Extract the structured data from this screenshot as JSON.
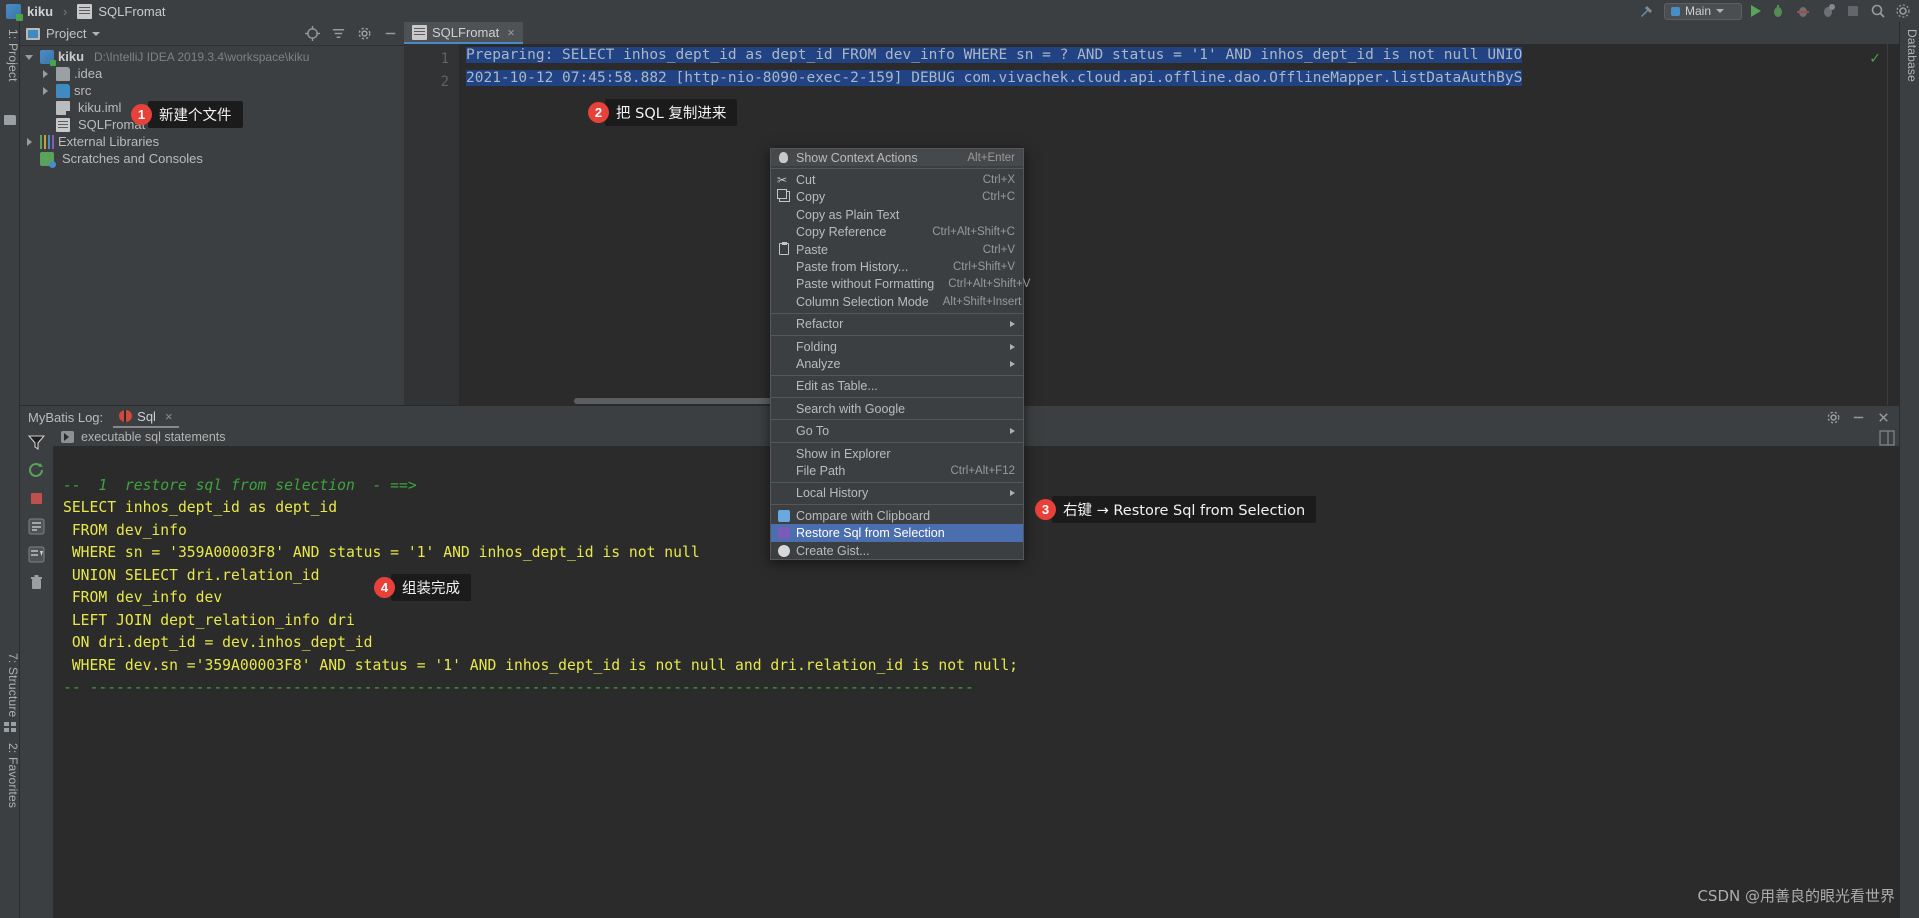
{
  "window": {
    "breadcrumb": {
      "project": "kiku",
      "file": "SQLFromat",
      "separator": "›"
    },
    "run_config": "Main"
  },
  "project_panel": {
    "title": "Project",
    "tree": [
      {
        "label": "kiku",
        "path": "D:\\IntelliJ IDEA 2019.3.4\\workspace\\kiku",
        "icon": "module-icon",
        "expanded": true,
        "depth": 0
      },
      {
        "label": ".idea",
        "path": "",
        "icon": "folder-icon",
        "expanded": false,
        "depth": 1
      },
      {
        "label": "src",
        "path": "",
        "icon": "source-folder-icon",
        "expanded": false,
        "depth": 1
      },
      {
        "label": "kiku.iml",
        "path": "",
        "icon": "iml-file-icon",
        "expanded": null,
        "depth": 1
      },
      {
        "label": "SQLFromat",
        "path": "",
        "icon": "text-file-icon",
        "expanded": null,
        "depth": 1
      },
      {
        "label": "External Libraries",
        "path": "",
        "icon": "libraries-icon",
        "expanded": false,
        "depth": 0
      },
      {
        "label": "Scratches and Consoles",
        "path": "",
        "icon": "scratches-icon",
        "expanded": null,
        "depth": 0
      }
    ]
  },
  "left_tool_strip": {
    "project_tab": "1: Project",
    "structure_tab": "7: Structure",
    "favorites_tab": "2: Favorites"
  },
  "right_tool_strip": {
    "database_tab": "Database"
  },
  "editor": {
    "tab_label": "SQLFromat",
    "tab_close": "×",
    "line_numbers": [
      "1",
      "2"
    ],
    "lines": [
      "Preparing: SELECT inhos_dept_id as dept_id FROM dev_info WHERE sn = ? AND status = '1' AND inhos_dept_id is not null UNIO",
      "2021-10-12 07:45:58.882 [http-nio-8090-exec-2-159] DEBUG com.vivachek.cloud.api.offline.dao.OfflineMapper.listDataAuthByS"
    ]
  },
  "context_menu": {
    "items": [
      {
        "label": "Show Context Actions",
        "shortcut": "Alt+Enter",
        "icon": "lightbulb-icon",
        "submenu": false,
        "state": "hover-first"
      },
      {
        "type": "separator"
      },
      {
        "label": "Cut",
        "shortcut": "Ctrl+X",
        "icon": "scissors-icon",
        "submenu": false
      },
      {
        "label": "Copy",
        "shortcut": "Ctrl+C",
        "icon": "copy-icon",
        "submenu": false
      },
      {
        "label": "Copy as Plain Text",
        "shortcut": "",
        "icon": "",
        "submenu": false
      },
      {
        "label": "Copy Reference",
        "shortcut": "Ctrl+Alt+Shift+C",
        "icon": "",
        "submenu": false
      },
      {
        "label": "Paste",
        "shortcut": "Ctrl+V",
        "icon": "paste-icon",
        "submenu": false
      },
      {
        "label": "Paste from History...",
        "shortcut": "Ctrl+Shift+V",
        "icon": "",
        "submenu": false
      },
      {
        "label": "Paste without Formatting",
        "shortcut": "Ctrl+Alt+Shift+V",
        "icon": "",
        "submenu": false
      },
      {
        "label": "Column Selection Mode",
        "shortcut": "Alt+Shift+Insert",
        "icon": "",
        "submenu": false
      },
      {
        "type": "separator"
      },
      {
        "label": "Refactor",
        "shortcut": "",
        "icon": "",
        "submenu": true
      },
      {
        "type": "separator"
      },
      {
        "label": "Folding",
        "shortcut": "",
        "icon": "",
        "submenu": true
      },
      {
        "label": "Analyze",
        "shortcut": "",
        "icon": "",
        "submenu": true
      },
      {
        "type": "separator"
      },
      {
        "label": "Edit as Table...",
        "shortcut": "",
        "icon": "",
        "submenu": false
      },
      {
        "type": "separator"
      },
      {
        "label": "Search with Google",
        "shortcut": "",
        "icon": "",
        "submenu": false
      },
      {
        "type": "separator"
      },
      {
        "label": "Go To",
        "shortcut": "",
        "icon": "",
        "submenu": true
      },
      {
        "type": "separator"
      },
      {
        "label": "Show in Explorer",
        "shortcut": "",
        "icon": "",
        "submenu": false
      },
      {
        "label": "File Path",
        "shortcut": "Ctrl+Alt+F12",
        "icon": "",
        "submenu": false
      },
      {
        "type": "separator"
      },
      {
        "label": "Local History",
        "shortcut": "",
        "icon": "",
        "submenu": true
      },
      {
        "type": "separator"
      },
      {
        "label": "Compare with Clipboard",
        "shortcut": "",
        "icon": "clipboard-compare-icon",
        "submenu": false
      },
      {
        "label": "Restore Sql from Selection",
        "shortcut": "",
        "icon": "restore-sql-icon",
        "submenu": false,
        "state": "selected"
      },
      {
        "label": "Create Gist...",
        "shortcut": "",
        "icon": "github-icon",
        "submenu": false
      }
    ]
  },
  "log_panel": {
    "title": "MyBatis Log:",
    "tab_label": "Sql",
    "tab_close": "×",
    "filter_label": "executable sql statements",
    "sql_lines": [
      {
        "text": "--  1  restore sql from selection  - ==>",
        "style": "comment"
      },
      {
        "text": "SELECT inhos_dept_id as dept_id",
        "style": "sql"
      },
      {
        "text": " FROM dev_info",
        "style": "sql"
      },
      {
        "text": " WHERE sn = '359A00003F8' AND status = '1' AND inhos_dept_id is not null",
        "style": "sql"
      },
      {
        "text": " UNION SELECT dri.relation_id",
        "style": "sql"
      },
      {
        "text": " FROM dev_info dev",
        "style": "sql"
      },
      {
        "text": " LEFT JOIN dept_relation_info dri",
        "style": "sql"
      },
      {
        "text": " ON dri.dept_id = dev.inhos_dept_id",
        "style": "sql"
      },
      {
        "text": " WHERE dev.sn ='359A00003F8' AND status = '1' AND inhos_dept_id is not null and dri.relation_id is not null;",
        "style": "sql"
      },
      {
        "text": "-- ----------------------------------------------------------------------------------------------------",
        "style": "dash"
      }
    ]
  },
  "callouts": [
    {
      "number": "1",
      "text": "新建个文件"
    },
    {
      "number": "2",
      "text": "把 SQL 复制进来"
    },
    {
      "number": "3",
      "text": "右键 → Restore Sql from Selection"
    },
    {
      "number": "4",
      "text": "组装完成"
    }
  ],
  "watermark": "CSDN @用善良的眼光看世界",
  "colors": {
    "accent_blue": "#4b6eaf",
    "selection_blue": "#214283",
    "sql_yellow": "#e8e84a",
    "comment_green": "#3ea33e",
    "badge_red": "#e8413a",
    "panel_bg": "#3c3f41",
    "editor_bg": "#2b2b2b"
  }
}
